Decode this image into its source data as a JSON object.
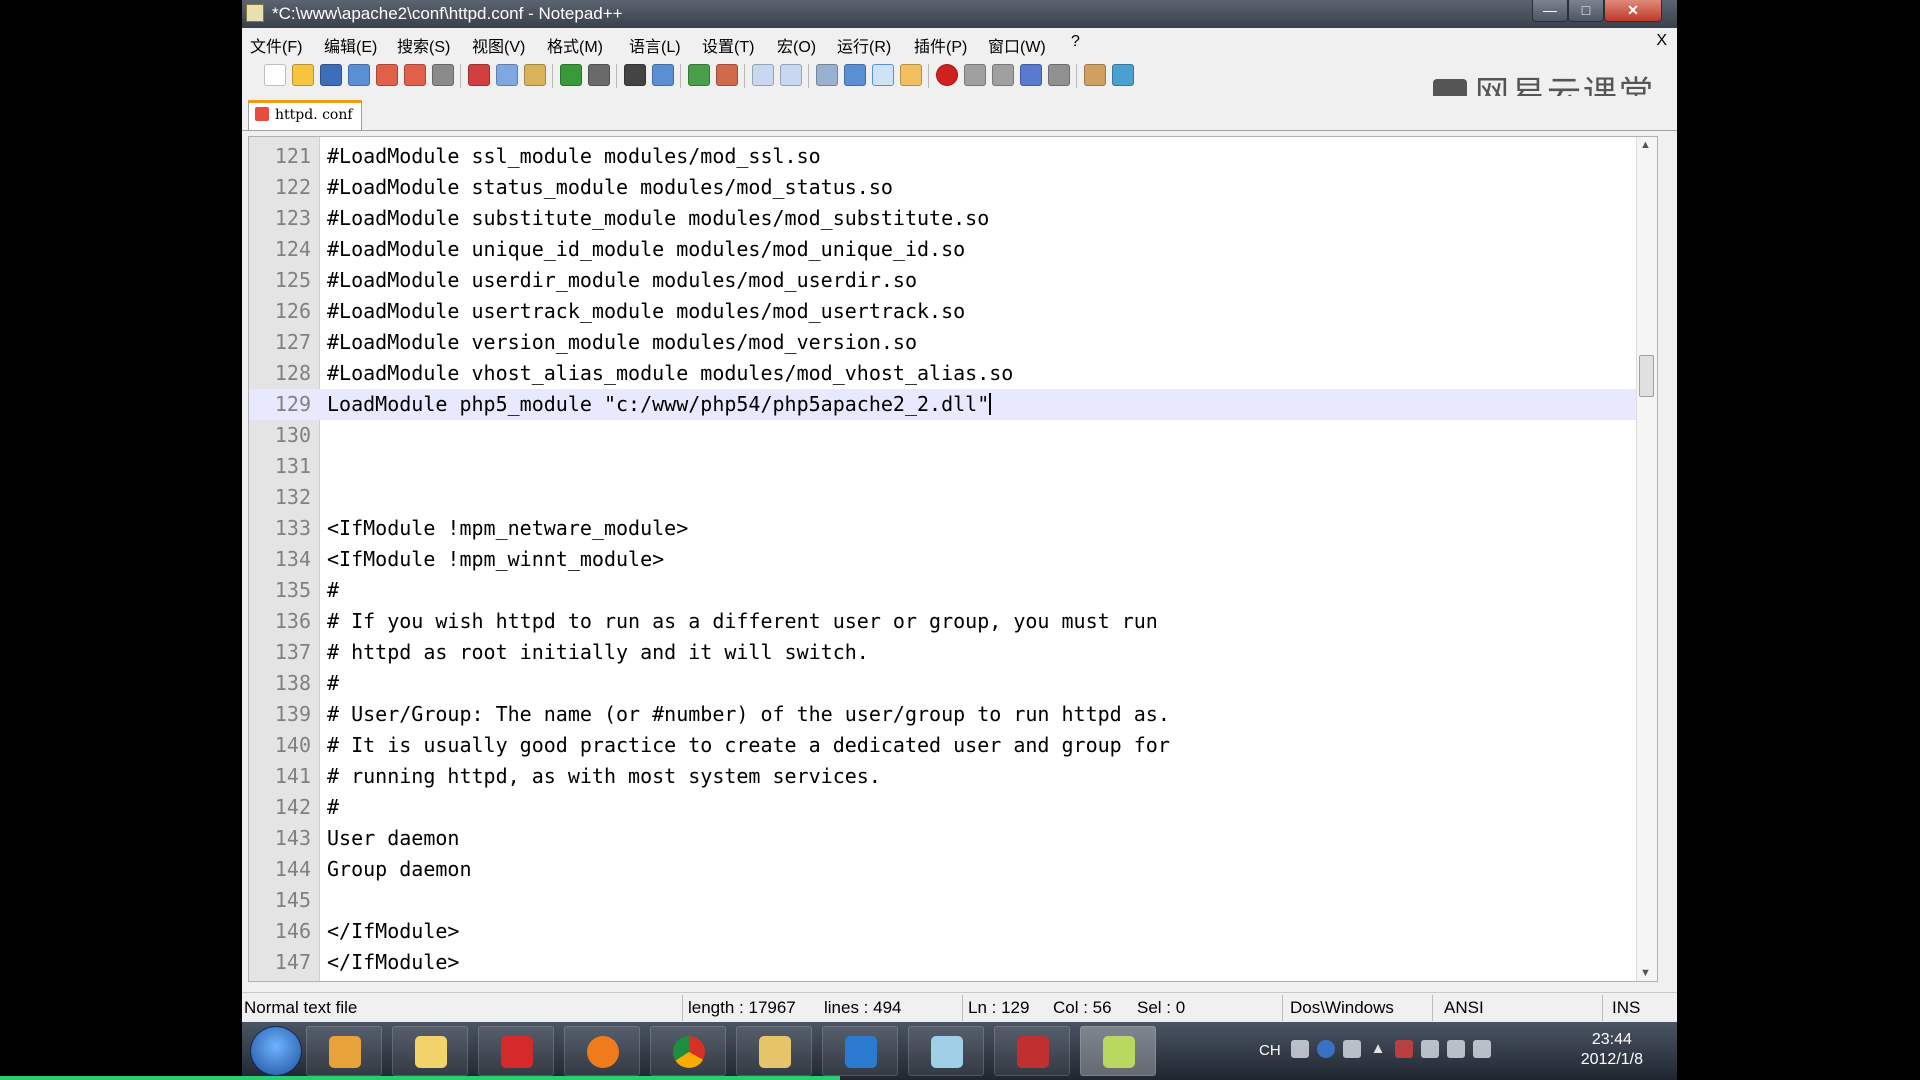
{
  "window": {
    "title": "*C:\\www\\apache2\\conf\\httpd.conf - Notepad++",
    "close_tab_glyph": "X"
  },
  "menu": [
    "文件(F)",
    "编辑(E)",
    "搜索(S)",
    "视图(V)",
    "格式(M)",
    "语言(L)",
    "设置(T)",
    "宏(O)",
    "运行(R)",
    "插件(P)",
    "窗口(W)",
    "?"
  ],
  "brand": {
    "text": "网易云课堂"
  },
  "tab": {
    "label": "httpd. conf"
  },
  "editor": {
    "current_line": 129,
    "lines": [
      {
        "n": "121",
        "text": "#LoadModule ssl_module modules/mod_ssl.so"
      },
      {
        "n": "122",
        "text": "#LoadModule status_module modules/mod_status.so"
      },
      {
        "n": "123",
        "text": "#LoadModule substitute_module modules/mod_substitute.so"
      },
      {
        "n": "124",
        "text": "#LoadModule unique_id_module modules/mod_unique_id.so"
      },
      {
        "n": "125",
        "text": "#LoadModule userdir_module modules/mod_userdir.so"
      },
      {
        "n": "126",
        "text": "#LoadModule usertrack_module modules/mod_usertrack.so"
      },
      {
        "n": "127",
        "text": "#LoadModule version_module modules/mod_version.so"
      },
      {
        "n": "128",
        "text": "#LoadModule vhost_alias_module modules/mod_vhost_alias.so"
      },
      {
        "n": "129",
        "text": "LoadModule php5_module \"c:/www/php54/php5apache2_2.dll\""
      },
      {
        "n": "130",
        "text": ""
      },
      {
        "n": "131",
        "text": ""
      },
      {
        "n": "132",
        "text": ""
      },
      {
        "n": "133",
        "text": "<IfModule !mpm_netware_module>"
      },
      {
        "n": "134",
        "text": "<IfModule !mpm_winnt_module>"
      },
      {
        "n": "135",
        "text": "#"
      },
      {
        "n": "136",
        "text": "# If you wish httpd to run as a different user or group, you must run"
      },
      {
        "n": "137",
        "text": "# httpd as root initially and it will switch."
      },
      {
        "n": "138",
        "text": "#"
      },
      {
        "n": "139",
        "text": "# User/Group: The name (or #number) of the user/group to run httpd as."
      },
      {
        "n": "140",
        "text": "# It is usually good practice to create a dedicated user and group for"
      },
      {
        "n": "141",
        "text": "# running httpd, as with most system services."
      },
      {
        "n": "142",
        "text": "#"
      },
      {
        "n": "143",
        "text": "User daemon"
      },
      {
        "n": "144",
        "text": "Group daemon"
      },
      {
        "n": "145",
        "text": ""
      },
      {
        "n": "146",
        "text": "</IfModule>"
      },
      {
        "n": "147",
        "text": "</IfModule>"
      }
    ]
  },
  "status": {
    "file_type": "Normal text file",
    "length": "length : 17967",
    "lines": "lines : 494",
    "ln": "Ln : 129",
    "col": "Col : 56",
    "sel": "Sel : 0",
    "eol": "Dos\\Windows",
    "encoding": "ANSI",
    "mode": "INS"
  },
  "taskbar": {
    "language": "CH",
    "time": "23:44",
    "date": "2012/1/8"
  },
  "icons": {
    "titlebar": "notepadpp-icon",
    "tab": "save-icon",
    "brand": "netease-cloud-classroom-icon"
  },
  "colors": {
    "current_line_bg": "#e8e8ff",
    "gutter_bg": "#e4e4e4",
    "line_number": "#808080",
    "tab_accent": "#f39c12"
  }
}
